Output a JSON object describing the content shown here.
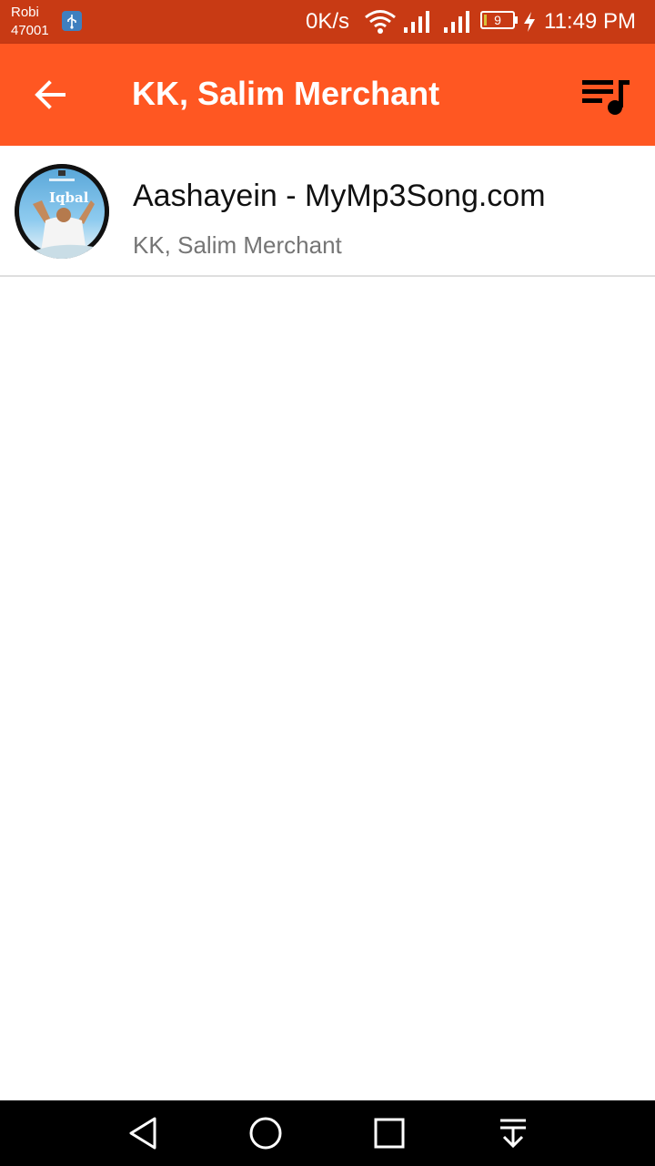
{
  "status_bar": {
    "carrier_name": "Robi",
    "carrier_code": "47001",
    "network_speed": "0K/s",
    "battery_level": "9",
    "battery_fraction": 0.09,
    "time": "11:49 PM",
    "icons": [
      "usb-icon",
      "wifi-icon",
      "signal-icon",
      "signal-icon",
      "battery-icon",
      "charging-icon"
    ]
  },
  "app_bar": {
    "title": "KK, Salim Merchant",
    "back_icon": "arrow-back-icon",
    "queue_icon": "queue-music-icon"
  },
  "songs": [
    {
      "title": "Aashayein - MyMp3Song.com",
      "artist": "KK, Salim Merchant",
      "album_art_text": "Iqbal"
    }
  ],
  "nav_bar": {
    "icons": [
      "nav-back-icon",
      "nav-home-icon",
      "nav-recents-icon",
      "nav-notifications-icon"
    ]
  },
  "colors": {
    "status_bar": "#c83a14",
    "app_bar": "#ff5722",
    "title_text": "#ffffff",
    "song_title": "#111111",
    "song_artist": "#757575",
    "nav_bar": "#000000"
  }
}
